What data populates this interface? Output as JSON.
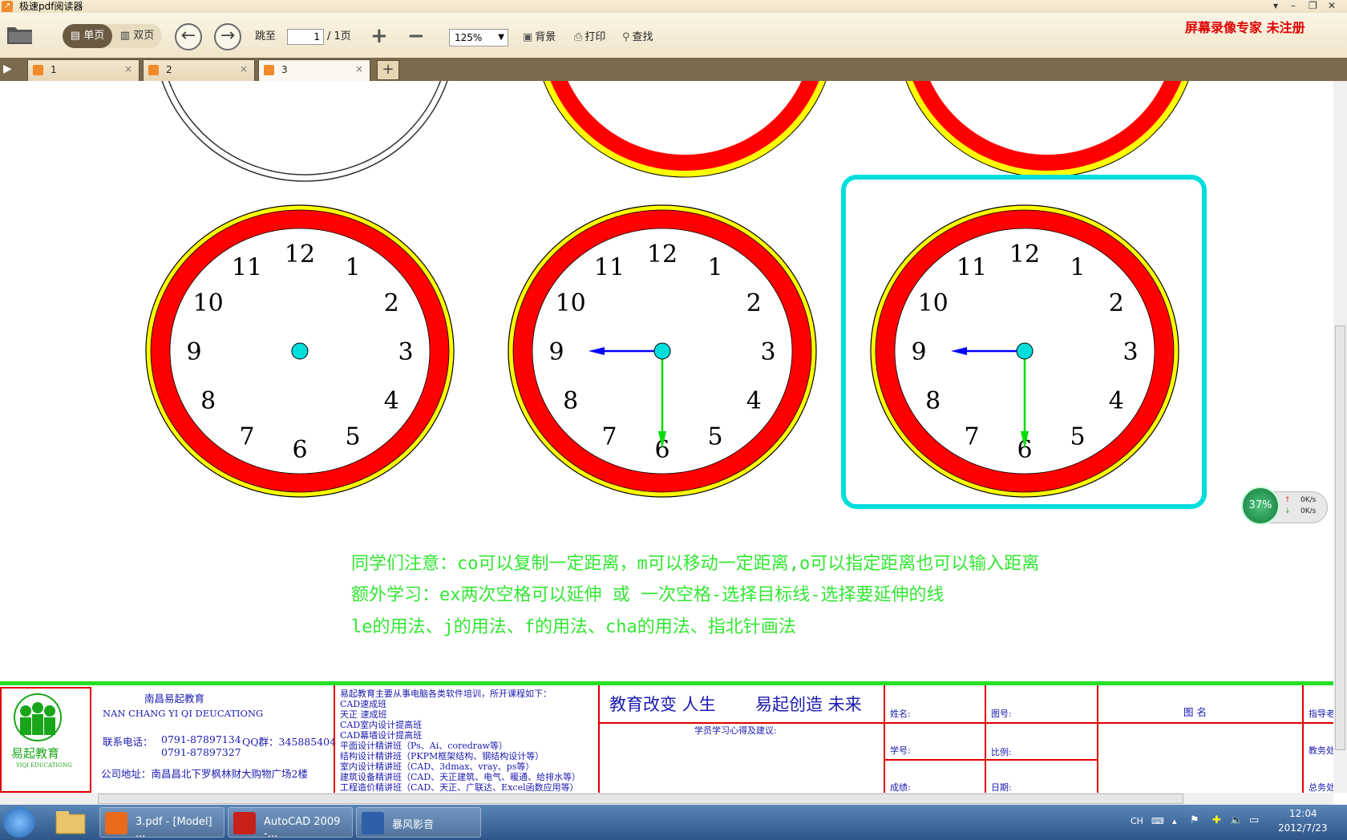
{
  "window": {
    "title": "极速pdf阅读器",
    "controls": [
      "▾",
      "–",
      "❐",
      "✕"
    ]
  },
  "toolbar": {
    "view_single": "单页",
    "view_double": "双页",
    "goto_label": "跳至",
    "page_value": "1",
    "page_total": "/ 1页",
    "zoom_value": "125%",
    "background_label": "背景",
    "print_label": "打印",
    "find_label": "查找",
    "recorder_text": "屏幕录像专家  未注册"
  },
  "tabs": [
    {
      "label": "1",
      "active": false
    },
    {
      "label": "2",
      "active": false
    },
    {
      "label": "3",
      "active": true
    }
  ],
  "clocks": {
    "numbers": [
      "12",
      "1",
      "2",
      "3",
      "4",
      "5",
      "6",
      "7",
      "8",
      "9",
      "10",
      "11"
    ],
    "items": [
      {
        "hands": false,
        "highlighted": false
      },
      {
        "hands": true,
        "highlighted": false
      },
      {
        "hands": true,
        "highlighted": true
      }
    ],
    "colors": {
      "outer": "#ffff00",
      "ring": "#ff0000",
      "center": "#00dddd",
      "hour_hand": "#0000ff",
      "minute_hand": "#00dd00",
      "frame": "#00dddd"
    }
  },
  "notes": [
    "同学们注意：co可以复制一定距离，m可以移动一定距离,o可以指定距离也可以输入距离",
    "额外学习：ex两次空格可以延伸 或 一次空格-选择目标线-选择要延伸的线",
    "le的用法、j的用法、f的用法、cha的用法、指北针画法"
  ],
  "titleblock": {
    "logo_text": "易起教育",
    "logo_sub": "YIQI EDUCATIONG",
    "school_name": "南昌易起教育",
    "school_pinyin": "NAN CHANG YI QI DEUCATIONG",
    "phone_label": "联系电话：",
    "phone1": "0791-87897134",
    "qq": "QQ群：345885404",
    "phone2": "0791-87897327",
    "address": "公司地址：南昌昌北下罗枫林财大购物广场2楼",
    "courses_intro": "易起教育主要从事电脑各类软件培训，所开课程如下：",
    "courses": [
      "CAD速成班",
      "天正 速成班",
      "CAD室内设计提高班",
      "CAD幕墙设计提高班",
      "平面设计精讲班（Ps、Ai、coredraw等）",
      "结构设计精讲班（PKPM框架结构、钢结构设计等）",
      "室内设计精讲班（CAD、3dmax、vray、ps等）",
      "建筑设备精讲班（CAD、天正建筑、电气、暖通、给排水等）",
      "工程造价精讲班（CAD、天正、广联达、Excel函数应用等）"
    ],
    "slogan1": "教育改变  人生",
    "slogan2": "易起创造  未来",
    "feedback": "学员学习心得及建议:",
    "name_label": "姓名:",
    "id_label": "学号:",
    "score_label": "成绩:",
    "drawing_no": "图号:",
    "scale": "比例:",
    "date": "日期:",
    "drawing_name": "图 名",
    "guide": "指导老",
    "dean": "教务处",
    "general": "总务处"
  },
  "net_widget": {
    "percent": "37%",
    "up": "0K/s",
    "down": "0K/s"
  },
  "taskbar": {
    "items": [
      {
        "label": "3.pdf - [Model] ..."
      },
      {
        "label": "AutoCAD 2009 -..."
      },
      {
        "label": "暴风影音"
      }
    ],
    "lang": "CH",
    "time": "12:04",
    "date": "2012/7/23"
  }
}
